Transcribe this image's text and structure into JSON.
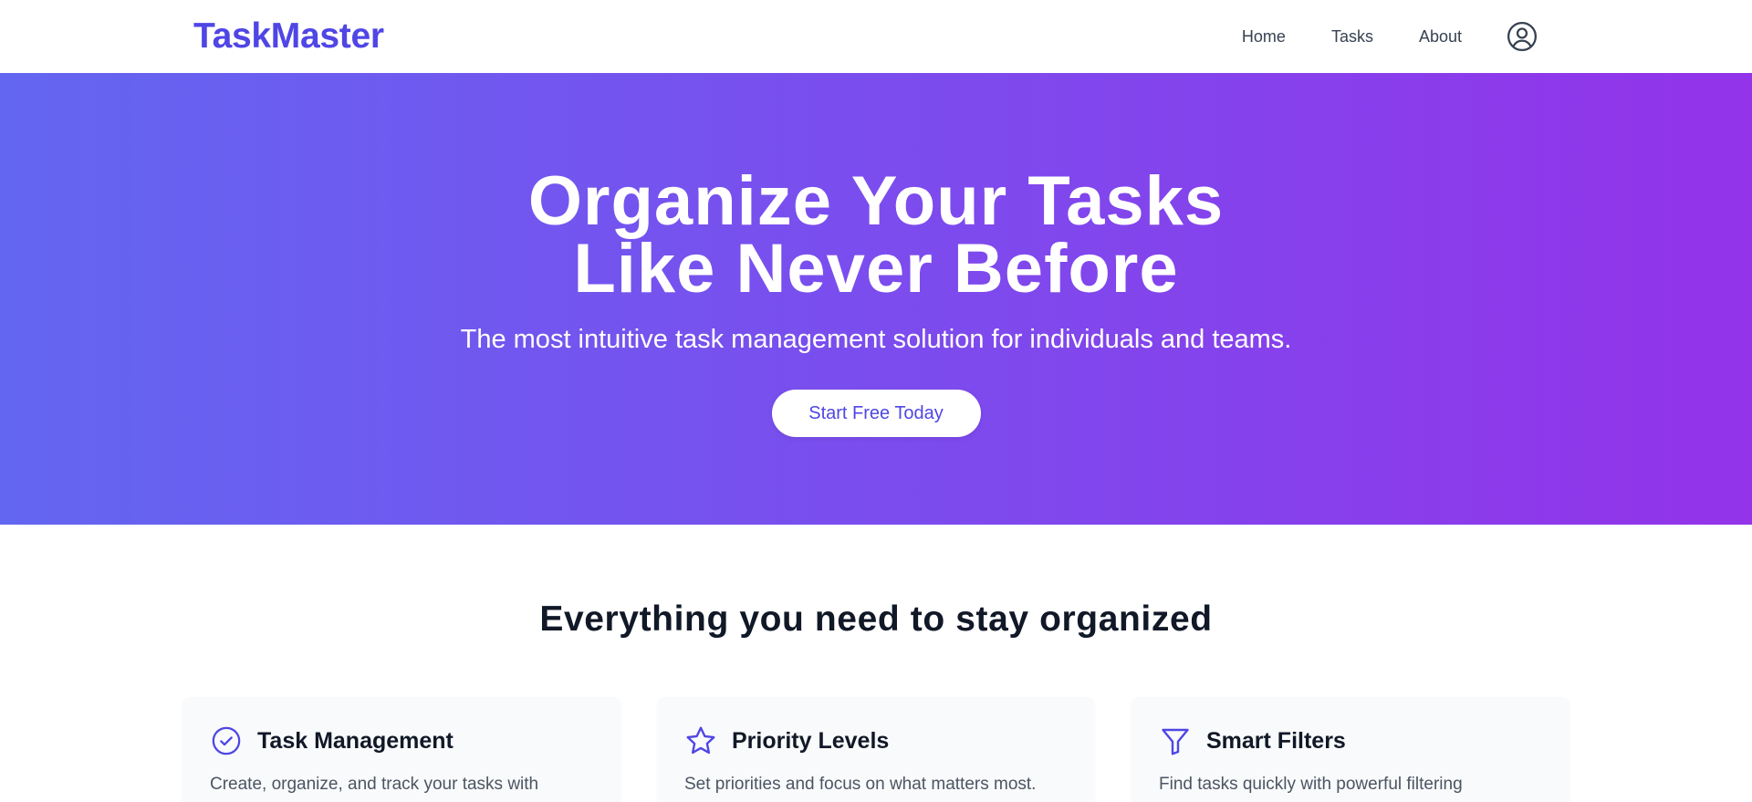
{
  "header": {
    "brand": "TaskMaster",
    "nav": [
      {
        "label": "Home"
      },
      {
        "label": "Tasks"
      },
      {
        "label": "About"
      }
    ],
    "profile_icon": "user-circle-icon"
  },
  "hero": {
    "title_line1": "Organize Your Tasks",
    "title_line2": "Like Never Before",
    "subtitle": "The most intuitive task management solution for individuals and teams.",
    "cta_label": "Start Free Today",
    "gradient": [
      "#6366f1",
      "#9333ea"
    ]
  },
  "features": {
    "title": "Everything you need to stay organized",
    "cards": [
      {
        "icon": "check-circle-icon",
        "title": "Task Management",
        "description": "Create, organize, and track your tasks with"
      },
      {
        "icon": "star-icon",
        "title": "Priority Levels",
        "description": "Set priorities and focus on what matters most."
      },
      {
        "icon": "filter-icon",
        "title": "Smart Filters",
        "description": "Find tasks quickly with powerful filtering"
      }
    ]
  },
  "colors": {
    "accent": "#4f46e5",
    "text_dark": "#111827",
    "text_muted": "#4b5563",
    "card_bg": "#f9fafb"
  }
}
